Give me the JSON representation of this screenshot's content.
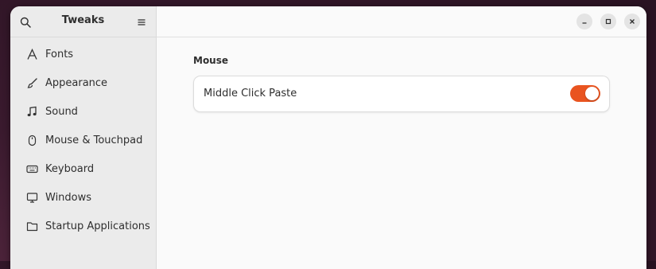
{
  "app": {
    "title": "Tweaks"
  },
  "sidebar": {
    "items": [
      {
        "label": "Fonts",
        "icon": "font-icon"
      },
      {
        "label": "Appearance",
        "icon": "brush-icon"
      },
      {
        "label": "Sound",
        "icon": "music-note-icon"
      },
      {
        "label": "Mouse & Touchpad",
        "icon": "mouse-icon"
      },
      {
        "label": "Keyboard",
        "icon": "keyboard-icon"
      },
      {
        "label": "Windows",
        "icon": "monitor-icon"
      },
      {
        "label": "Startup Applications",
        "icon": "folder-icon"
      }
    ],
    "selected_index": 3
  },
  "main": {
    "section_title": "Mouse",
    "settings": [
      {
        "label": "Middle Click Paste",
        "enabled": true
      }
    ]
  },
  "colors": {
    "accent": "#e95420",
    "sidebar_bg": "#ebebeb",
    "content_bg": "#fafafa"
  }
}
